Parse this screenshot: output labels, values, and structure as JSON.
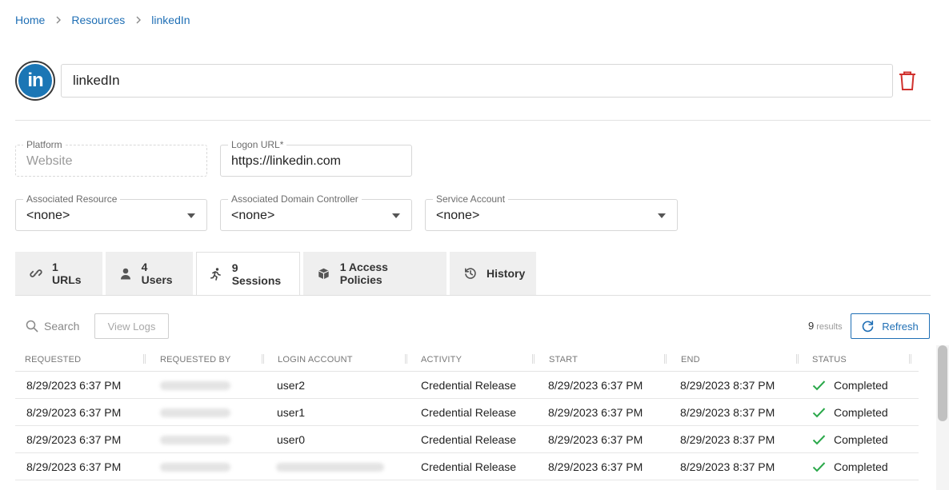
{
  "breadcrumb": {
    "items": [
      "Home",
      "Resources",
      "linkedIn"
    ]
  },
  "resource": {
    "name": "linkedIn",
    "logo_text": "in"
  },
  "fields": {
    "platform": {
      "label": "Platform",
      "value": "Website"
    },
    "logon_url": {
      "label": "Logon URL*",
      "value": "https://linkedin.com"
    },
    "associated_resource": {
      "label": "Associated Resource",
      "value": "<none>"
    },
    "associated_dc": {
      "label": "Associated Domain Controller",
      "value": "<none>"
    },
    "service_account": {
      "label": "Service Account",
      "value": "<none>"
    }
  },
  "tabs": [
    {
      "label": "1 URLs",
      "icon": "link-icon"
    },
    {
      "label": "4 Users",
      "icon": "user-icon"
    },
    {
      "label": "9 Sessions",
      "icon": "running-person-icon",
      "active": true
    },
    {
      "label": "1 Access Policies",
      "icon": "cube-icon"
    },
    {
      "label": "History",
      "icon": "history-icon"
    }
  ],
  "toolbar": {
    "search_placeholder": "Search",
    "view_logs_label": "View Logs",
    "results_count": "9",
    "results_label": "results",
    "refresh_label": "Refresh"
  },
  "table": {
    "columns": [
      "REQUESTED",
      "REQUESTED BY",
      "LOGIN ACCOUNT",
      "ACTIVITY",
      "START",
      "END",
      "STATUS"
    ],
    "rows": [
      {
        "requested": "8/29/2023 6:37 PM",
        "login_account": "user2",
        "activity": "Credential Release",
        "start": "8/29/2023 6:37 PM",
        "end": "8/29/2023 8:37 PM",
        "status": "Completed"
      },
      {
        "requested": "8/29/2023 6:37 PM",
        "login_account": "user1",
        "activity": "Credential Release",
        "start": "8/29/2023 6:37 PM",
        "end": "8/29/2023 8:37 PM",
        "status": "Completed"
      },
      {
        "requested": "8/29/2023 6:37 PM",
        "login_account": "user0",
        "activity": "Credential Release",
        "start": "8/29/2023 6:37 PM",
        "end": "8/29/2023 8:37 PM",
        "status": "Completed"
      },
      {
        "requested": "8/29/2023 6:37 PM",
        "login_account": "",
        "activity": "Credential Release",
        "start": "8/29/2023 6:37 PM",
        "end": "8/29/2023 8:37 PM",
        "status": "Completed"
      }
    ]
  },
  "colors": {
    "link": "#1f6fb5",
    "danger": "#d0312d",
    "success": "#2aa84a",
    "brand": "#1b76b5"
  }
}
